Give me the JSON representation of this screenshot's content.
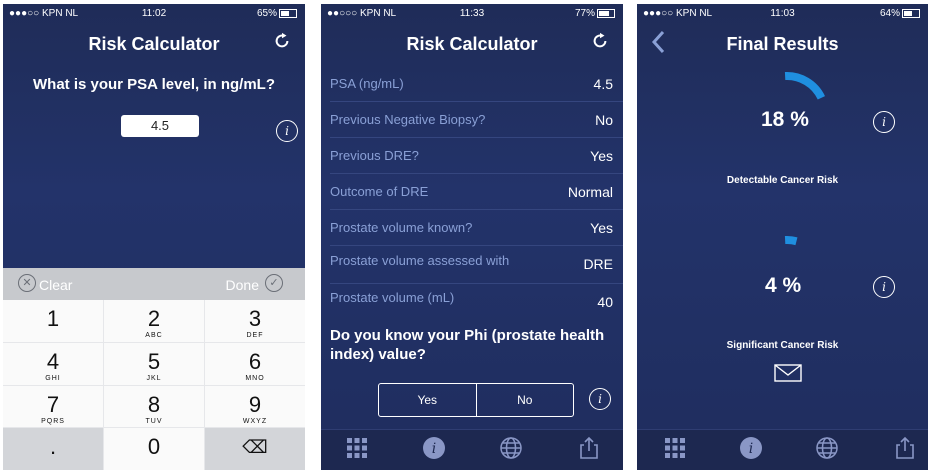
{
  "phones": [
    {
      "status": {
        "carrier": "●●●○○ KPN NL",
        "time": "11:02",
        "battery": "65%"
      },
      "title": "Risk Calculator",
      "question": "What is your PSA level, in ng/mL?",
      "psa_value": "4.5",
      "keyboard": {
        "clear_label": "Clear",
        "done_label": "Done",
        "keys": [
          {
            "digit": "1",
            "letters": ""
          },
          {
            "digit": "2",
            "letters": "ABC"
          },
          {
            "digit": "3",
            "letters": "DEF"
          },
          {
            "digit": "4",
            "letters": "GHI"
          },
          {
            "digit": "5",
            "letters": "JKL"
          },
          {
            "digit": "6",
            "letters": "MNO"
          },
          {
            "digit": "7",
            "letters": "PQRS"
          },
          {
            "digit": "8",
            "letters": "TUV"
          },
          {
            "digit": "9",
            "letters": "WXYZ"
          },
          {
            "digit": ".",
            "letters": ""
          },
          {
            "digit": "0",
            "letters": ""
          },
          {
            "digit": "⌫",
            "letters": ""
          }
        ]
      }
    },
    {
      "status": {
        "carrier": "●●○○○ KPN NL",
        "time": "11:33",
        "battery": "77%"
      },
      "title": "Risk Calculator",
      "rows": [
        {
          "label": "PSA (ng/mL)",
          "value": "4.5"
        },
        {
          "label": "Previous Negative Biopsy?",
          "value": "No"
        },
        {
          "label": "Previous DRE?",
          "value": "Yes"
        },
        {
          "label": "Outcome of DRE",
          "value": "Normal"
        },
        {
          "label": "Prostate volume known?",
          "value": "Yes"
        },
        {
          "label": "Prostate volume assessed with",
          "value": "DRE"
        },
        {
          "label": "Prostate volume (mL)",
          "value": "40"
        }
      ],
      "phi_question": "Do you know your Phi (prostate health index) value?",
      "yes_label": "Yes",
      "no_label": "No"
    },
    {
      "status": {
        "carrier": "●●●○○ KPN NL",
        "time": "11:03",
        "battery": "64%"
      },
      "title": "Final Results",
      "detectable": {
        "percent": "18 %",
        "label": "Detectable Cancer Risk",
        "fraction": 0.18
      },
      "significant": {
        "percent": "4 %",
        "label": "Significant Cancer Risk",
        "fraction": 0.04
      }
    }
  ],
  "tab_icons": [
    "grid-icon",
    "info-icon",
    "globe-icon",
    "share-icon"
  ],
  "colors": {
    "accent": "#1f8fe0",
    "background": "#22306a",
    "label": "#8aa0d6"
  }
}
